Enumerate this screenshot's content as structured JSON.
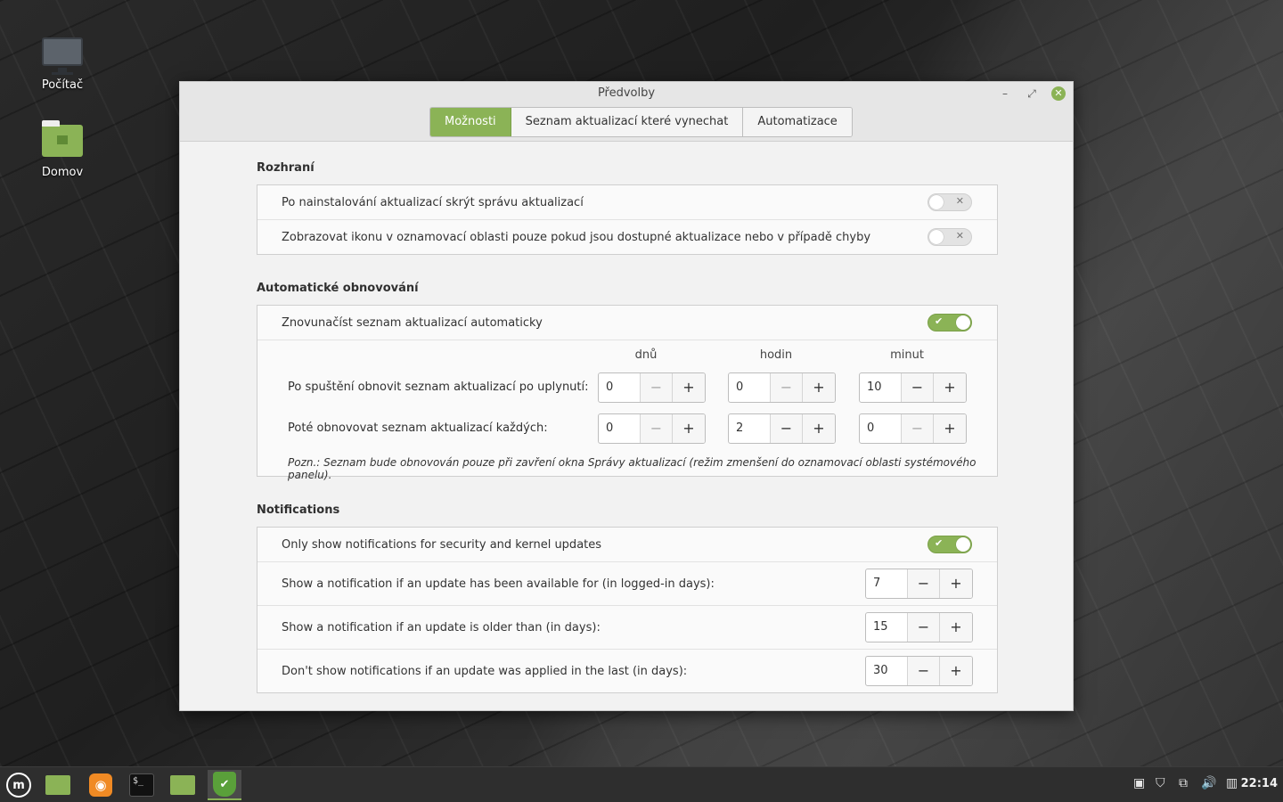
{
  "desktop": {
    "icons": [
      {
        "label": "Počítač",
        "icon": "computer-icon"
      },
      {
        "label": "Domov",
        "icon": "home-folder-icon"
      }
    ]
  },
  "window": {
    "title": "Předvolby",
    "controls": {
      "minimize": "–",
      "maximize": "⤢",
      "close": "✕"
    },
    "tabs": [
      {
        "label": "Možnosti",
        "active": true
      },
      {
        "label": "Seznam aktualizací které vynechat",
        "active": false
      },
      {
        "label": "Automatizace",
        "active": false
      }
    ],
    "accent": "#8bb356"
  },
  "interface": {
    "title": "Rozhraní",
    "rows": [
      {
        "label": "Po nainstalování aktualizací skrýt správu aktualizací",
        "enabled": false
      },
      {
        "label": "Zobrazovat ikonu v oznamovací oblasti pouze pokud jsou dostupné aktualizace nebo v případě chyby",
        "enabled": false
      }
    ]
  },
  "auto_refresh": {
    "title": "Automatické obnovování",
    "toggle_label": "Znovunačíst seznam aktualizací automaticky",
    "toggle_enabled": true,
    "columns": [
      "dnů",
      "hodin",
      "minut"
    ],
    "rows": [
      {
        "label": "Po spuštění obnovit seznam aktualizací po uplynutí:",
        "values": [
          "0",
          "0",
          "10"
        ]
      },
      {
        "label": "Poté obnovovat seznam aktualizací každých:",
        "values": [
          "0",
          "2",
          "0"
        ]
      }
    ],
    "note": "Pozn.: Seznam bude obnovován pouze při zavření okna Správy aktualizací (režim zmenšení do oznamovací oblasti systémového panelu)."
  },
  "notifications": {
    "title": "Notifications",
    "toggle_label": "Only show notifications for security and kernel updates",
    "toggle_enabled": true,
    "rows": [
      {
        "label": "Show a notification if an update has been available for (in logged-in days):",
        "value": "7"
      },
      {
        "label": "Show a notification if an update is older than (in days):",
        "value": "15"
      },
      {
        "label": "Don't show notifications if an update was applied in the last (in days):",
        "value": "30"
      }
    ]
  },
  "spin": {
    "minus": "−",
    "plus": "+"
  },
  "switch_marks": {
    "on": "✔",
    "off": "✕"
  },
  "taskbar": {
    "menu_label": "m",
    "terminal_prompt": "$_",
    "shield_glyph": "✔",
    "tray_icons": [
      "clipboard-icon",
      "shield-icon",
      "network-icon",
      "volume-icon",
      "battery-icon"
    ],
    "tray_glyphs": [
      "▣",
      "⛉",
      "⧉",
      "🔊",
      "▥"
    ],
    "clock": "22:14"
  }
}
